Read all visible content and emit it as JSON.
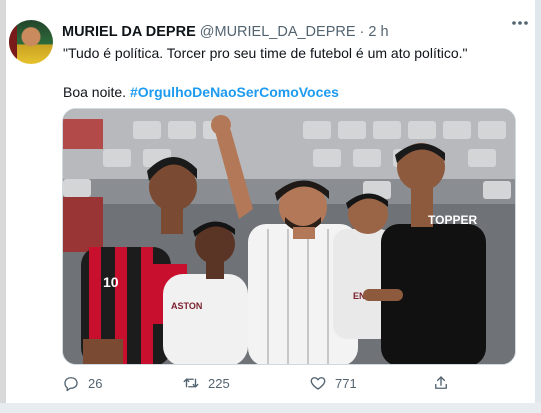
{
  "tweet": {
    "author_name": "MURIEL DA DEPRE",
    "handle": "@MURIEL_DA_DEPRE",
    "separator": "·",
    "time": "2 h",
    "text_line1": "\"Tudo é política. Torcer pro seu time de futebol é um ato político.\"",
    "text_line2": "Boa noite.",
    "hashtag": "#OrgulhoDeNaoSerComoVoces"
  },
  "photo": {
    "shirt_number": "10",
    "left_shirt_text": "ASTON",
    "right_shirt_text": "TOPPER",
    "center_shirt_text": "ENE"
  },
  "actions": {
    "reply_count": "26",
    "retweet_count": "225",
    "like_count": "771"
  },
  "colors": {
    "accent": "#1d9bf0",
    "muted": "#536471",
    "flamengo_red": "#c8102e",
    "fluminense_white": "#f3f3f3"
  }
}
